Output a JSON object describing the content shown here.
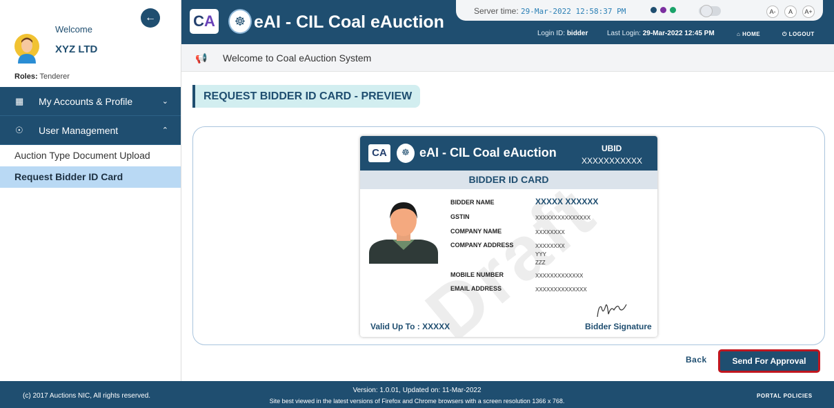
{
  "sidebar": {
    "welcome": "Welcome",
    "company_name": "XYZ LTD",
    "roles_label": "Roles:",
    "roles_value": "Tenderer",
    "menus": [
      {
        "label": "My Accounts & Profile",
        "icon": "id-card-icon",
        "expanded": false
      },
      {
        "label": "User Management",
        "icon": "users-gear-icon",
        "expanded": true
      }
    ],
    "sub_items": [
      {
        "label": "Auction Type Document Upload",
        "active": false
      },
      {
        "label": "Request Bidder ID Card",
        "active": true
      }
    ]
  },
  "header": {
    "app_title": "eAI - CIL Coal eAuction",
    "server_time_label": "Server time:",
    "server_time_value": "29-Mar-2022 12:58:37 PM",
    "login_id_label": "Login ID:",
    "login_id_value": "bidder",
    "last_login_label": "Last Login:",
    "last_login_value": "29-Mar-2022 12:45 PM",
    "home_label": "HOME",
    "logout_label": "LOGOUT",
    "font_size_buttons": [
      "A-",
      "A",
      "A+"
    ],
    "theme_colors": [
      "#1f4e70",
      "#7b2fa0",
      "#1aa36a"
    ]
  },
  "notice": {
    "text": "Welcome to Coal eAuction System"
  },
  "main": {
    "page_title": "REQUEST BIDDER ID CARD - PREVIEW",
    "back_label": "Back",
    "approve_label": "Send For Approval"
  },
  "id_card": {
    "title": "eAI - CIL Coal eAuction",
    "ubid_label": "UBID",
    "ubid_value": "XXXXXXXXXXX",
    "subtitle": "BIDDER ID CARD",
    "watermark": "Draft",
    "fields": {
      "bidder_name_label": "BIDDER NAME",
      "bidder_name_value": "XXXXX XXXXXX",
      "gstin_label": "GSTIN",
      "gstin_value": "XXXXXXXXXXXXXXX",
      "company_name_label": "COMPANY NAME",
      "company_name_value": "XXXXXXXX",
      "company_address_label": "COMPANY ADDRESS",
      "company_address_line1": "XXXXXXXX",
      "company_address_line2": "YYY",
      "company_address_line3": "ZZZ",
      "mobile_label": "MOBILE NUMBER",
      "mobile_value": "XXXXXXXXXXXXX",
      "email_label": "EMAIL ADDRESS",
      "email_value": "XXXXXXXXXXXXXX"
    },
    "valid_label": "Valid Up To : XXXXX",
    "signature_label": "Bidder Signature"
  },
  "footer": {
    "copyright": "(c) 2017 Auctions NIC, All rights reserved.",
    "version": "Version: 1.0.01, Updated on: 11-Mar-2022",
    "best_view": "Site best viewed in the latest versions of Firefox and Chrome browsers with a screen resolution 1366 x 768.",
    "policies": "PORTAL POLICIES"
  }
}
